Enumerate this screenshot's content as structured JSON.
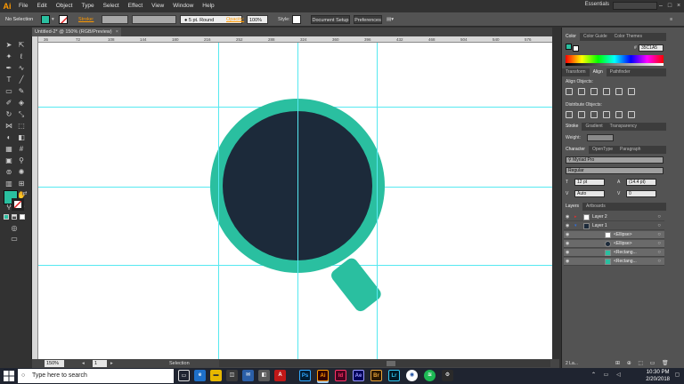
{
  "app": {
    "logo": "Ai"
  },
  "menu": [
    "File",
    "Edit",
    "Object",
    "Type",
    "Select",
    "Effect",
    "View",
    "Window",
    "Help"
  ],
  "workspace": {
    "label": "Essentials"
  },
  "control_bar": {
    "selection_label": "No Selection",
    "stroke_label": "Stroke:",
    "brush_label": "5 pt. Round",
    "opacity_label": "Opacity:",
    "opacity_value": "100%",
    "style_label": "Style:",
    "document_setup": "Document Setup",
    "preferences": "Preferences"
  },
  "document": {
    "tab_title": "Untitled-2* @ 150% (RGB/Preview)",
    "close": "×"
  },
  "ruler_ticks": [
    "36",
    "72",
    "108",
    "144",
    "180",
    "216",
    "252",
    "288",
    "324",
    "360",
    "396",
    "432",
    "468",
    "504",
    "540",
    "576"
  ],
  "colors": {
    "teal": "#2abfa0",
    "navy": "#1c2a3a",
    "guide": "#56e8f0",
    "accent": "#ff9a00"
  },
  "color_panel": {
    "tabs": [
      "Color",
      "Color Guide",
      "Color Themes"
    ],
    "hex_label": "#",
    "hex_value": "35C1A5"
  },
  "align_panel": {
    "tabs": [
      "Transform",
      "Align",
      "Pathfinder"
    ],
    "align_objects": "Align Objects:",
    "distribute_objects": "Distribute Objects:"
  },
  "stroke_panel": {
    "tabs": [
      "Stroke",
      "Gradient",
      "Transparency"
    ],
    "weight_label": "Weight:"
  },
  "character_panel": {
    "tabs": [
      "Character",
      "OpenType",
      "Paragraph"
    ],
    "font_family": "Myriad Pro",
    "font_style": "Regular",
    "font_size": "12 pt",
    "leading": "(14.4 pt)",
    "kerning": "Auto",
    "tracking": "0"
  },
  "layers_panel": {
    "tabs": [
      "Layers",
      "Artboards"
    ],
    "rows": [
      {
        "name": "Layer 2",
        "indent": 0
      },
      {
        "name": "Layer 1",
        "indent": 0
      },
      {
        "name": "<Ellipse>",
        "indent": 1
      },
      {
        "name": "<Ellipse>",
        "indent": 1
      },
      {
        "name": "<Rectang...",
        "indent": 1
      },
      {
        "name": "<Rectang...",
        "indent": 1
      }
    ],
    "footer": "2 La..."
  },
  "status_bar": {
    "zoom": "150%",
    "page": "1",
    "tool": "Selection"
  },
  "taskbar": {
    "search_placeholder": "Type here to search",
    "apps": [
      "Ps",
      "Ai",
      "Id",
      "Ae",
      "Br",
      "Lr"
    ],
    "time": "10:30 PM",
    "date": "2/20/2018"
  }
}
